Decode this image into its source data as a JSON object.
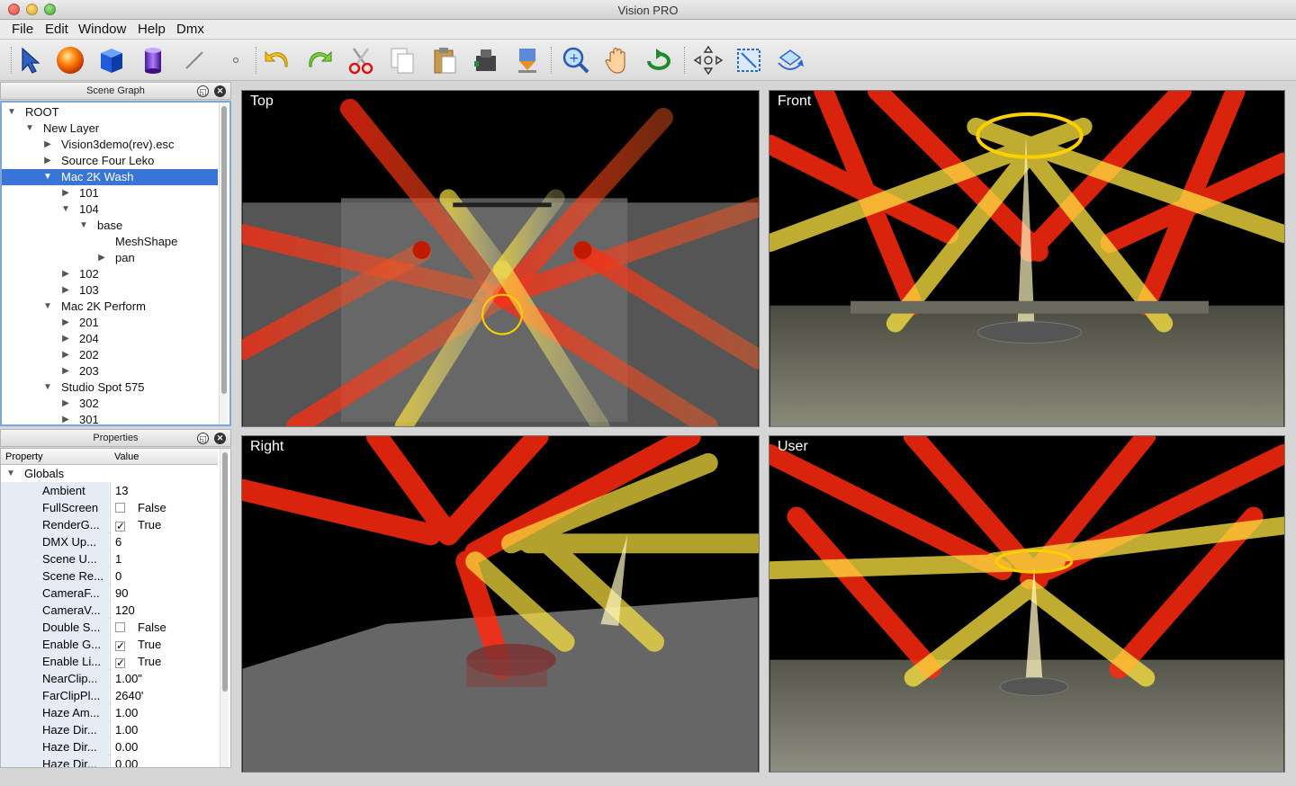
{
  "window": {
    "title": "Vision PRO"
  },
  "menu": [
    "File",
    "Edit",
    "Window",
    "Help",
    "Dmx"
  ],
  "toolbar": {
    "tools": [
      "select-arrow-icon",
      "sphere-icon",
      "cube-icon",
      "cylinder-icon",
      "line-icon",
      "point-icon",
      "undo-icon",
      "redo-icon",
      "cut-icon",
      "copy-icon",
      "paste-icon",
      "import-icon",
      "export-icon",
      "zoom-icon",
      "pan-hand-icon",
      "rotate-icon",
      "move-icon",
      "fit-icon",
      "orbit-icon"
    ]
  },
  "scene_graph": {
    "title": "Scene Graph",
    "items": [
      {
        "label": "ROOT",
        "depth": 0,
        "twisty": "open"
      },
      {
        "label": "New Layer",
        "depth": 1,
        "twisty": "open"
      },
      {
        "label": "Vision3demo(rev).esc",
        "depth": 2,
        "twisty": "closed"
      },
      {
        "label": "Source Four Leko",
        "depth": 2,
        "twisty": "closed"
      },
      {
        "label": "Mac 2K Wash",
        "depth": 2,
        "twisty": "open",
        "selected": true
      },
      {
        "label": "101",
        "depth": 3,
        "twisty": "closed"
      },
      {
        "label": "104",
        "depth": 3,
        "twisty": "open"
      },
      {
        "label": "base",
        "depth": 4,
        "twisty": "open"
      },
      {
        "label": "MeshShape",
        "depth": 5,
        "twisty": "none"
      },
      {
        "label": "pan",
        "depth": 5,
        "twisty": "closed"
      },
      {
        "label": "102",
        "depth": 3,
        "twisty": "closed"
      },
      {
        "label": "103",
        "depth": 3,
        "twisty": "closed"
      },
      {
        "label": "Mac 2K Perform",
        "depth": 2,
        "twisty": "open"
      },
      {
        "label": "201",
        "depth": 3,
        "twisty": "closed"
      },
      {
        "label": "204",
        "depth": 3,
        "twisty": "closed"
      },
      {
        "label": "202",
        "depth": 3,
        "twisty": "closed"
      },
      {
        "label": "203",
        "depth": 3,
        "twisty": "closed"
      },
      {
        "label": "Studio Spot 575",
        "depth": 2,
        "twisty": "open"
      },
      {
        "label": "302",
        "depth": 3,
        "twisty": "closed"
      },
      {
        "label": "301",
        "depth": 3,
        "twisty": "closed"
      }
    ]
  },
  "properties": {
    "title": "Properties",
    "col_property": "Property",
    "col_value": "Value",
    "group": "Globals",
    "rows": [
      {
        "key": "Ambient",
        "value": "13"
      },
      {
        "key": "FullScreen",
        "value": "False",
        "checkbox": false
      },
      {
        "key": "RenderG...",
        "value": "True",
        "checkbox": true
      },
      {
        "key": "DMX Up...",
        "value": "6"
      },
      {
        "key": "Scene U...",
        "value": "1"
      },
      {
        "key": "Scene Re...",
        "value": "0"
      },
      {
        "key": "CameraF...",
        "value": "90"
      },
      {
        "key": "CameraV...",
        "value": "120"
      },
      {
        "key": "Double S...",
        "value": "False",
        "checkbox": false
      },
      {
        "key": "Enable G...",
        "value": "True",
        "checkbox": true
      },
      {
        "key": "Enable Li...",
        "value": "True",
        "checkbox": true
      },
      {
        "key": "NearClip...",
        "value": "1.00\""
      },
      {
        "key": "FarClipPl...",
        "value": "2640'"
      },
      {
        "key": "Haze Am...",
        "value": "1.00"
      },
      {
        "key": "Haze Dir...",
        "value": "1.00"
      },
      {
        "key": "Haze Dir...",
        "value": "0.00"
      },
      {
        "key": "Haze Dir...",
        "value": "0.00"
      }
    ]
  },
  "viewports": [
    {
      "label": "Top"
    },
    {
      "label": "Front"
    },
    {
      "label": "Right"
    },
    {
      "label": "User"
    }
  ],
  "colors": {
    "selection": "#3875d7",
    "beam_red": "#ff2a10",
    "beam_yellow": "#ffe640",
    "floor": "#6e6e64"
  }
}
